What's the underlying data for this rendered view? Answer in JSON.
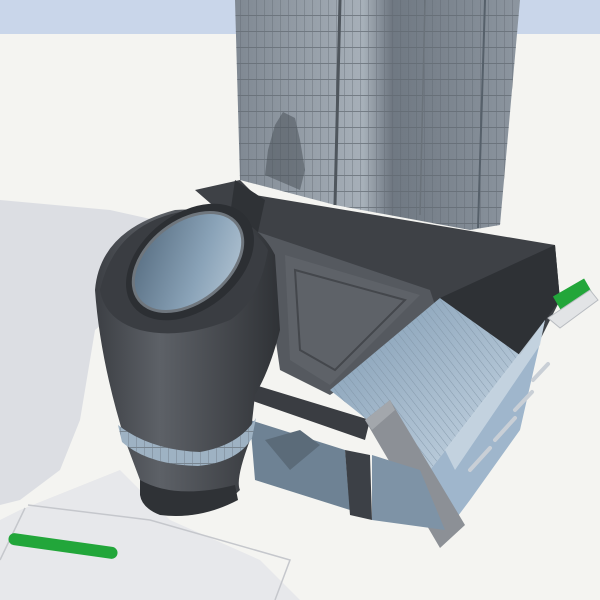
{
  "scene": {
    "kind": "3d-architectural-render",
    "colors": {
      "sky": "#c9d6ea",
      "ground": "#f4f4f1",
      "shadow": "#d9dbe0",
      "concrete_dark": "#4a4d52",
      "concrete_mid": "#6b6f75",
      "glass_light": "#9fb6cc",
      "glass_dark": "#5f7384",
      "accent_green": "#22a63a"
    }
  }
}
